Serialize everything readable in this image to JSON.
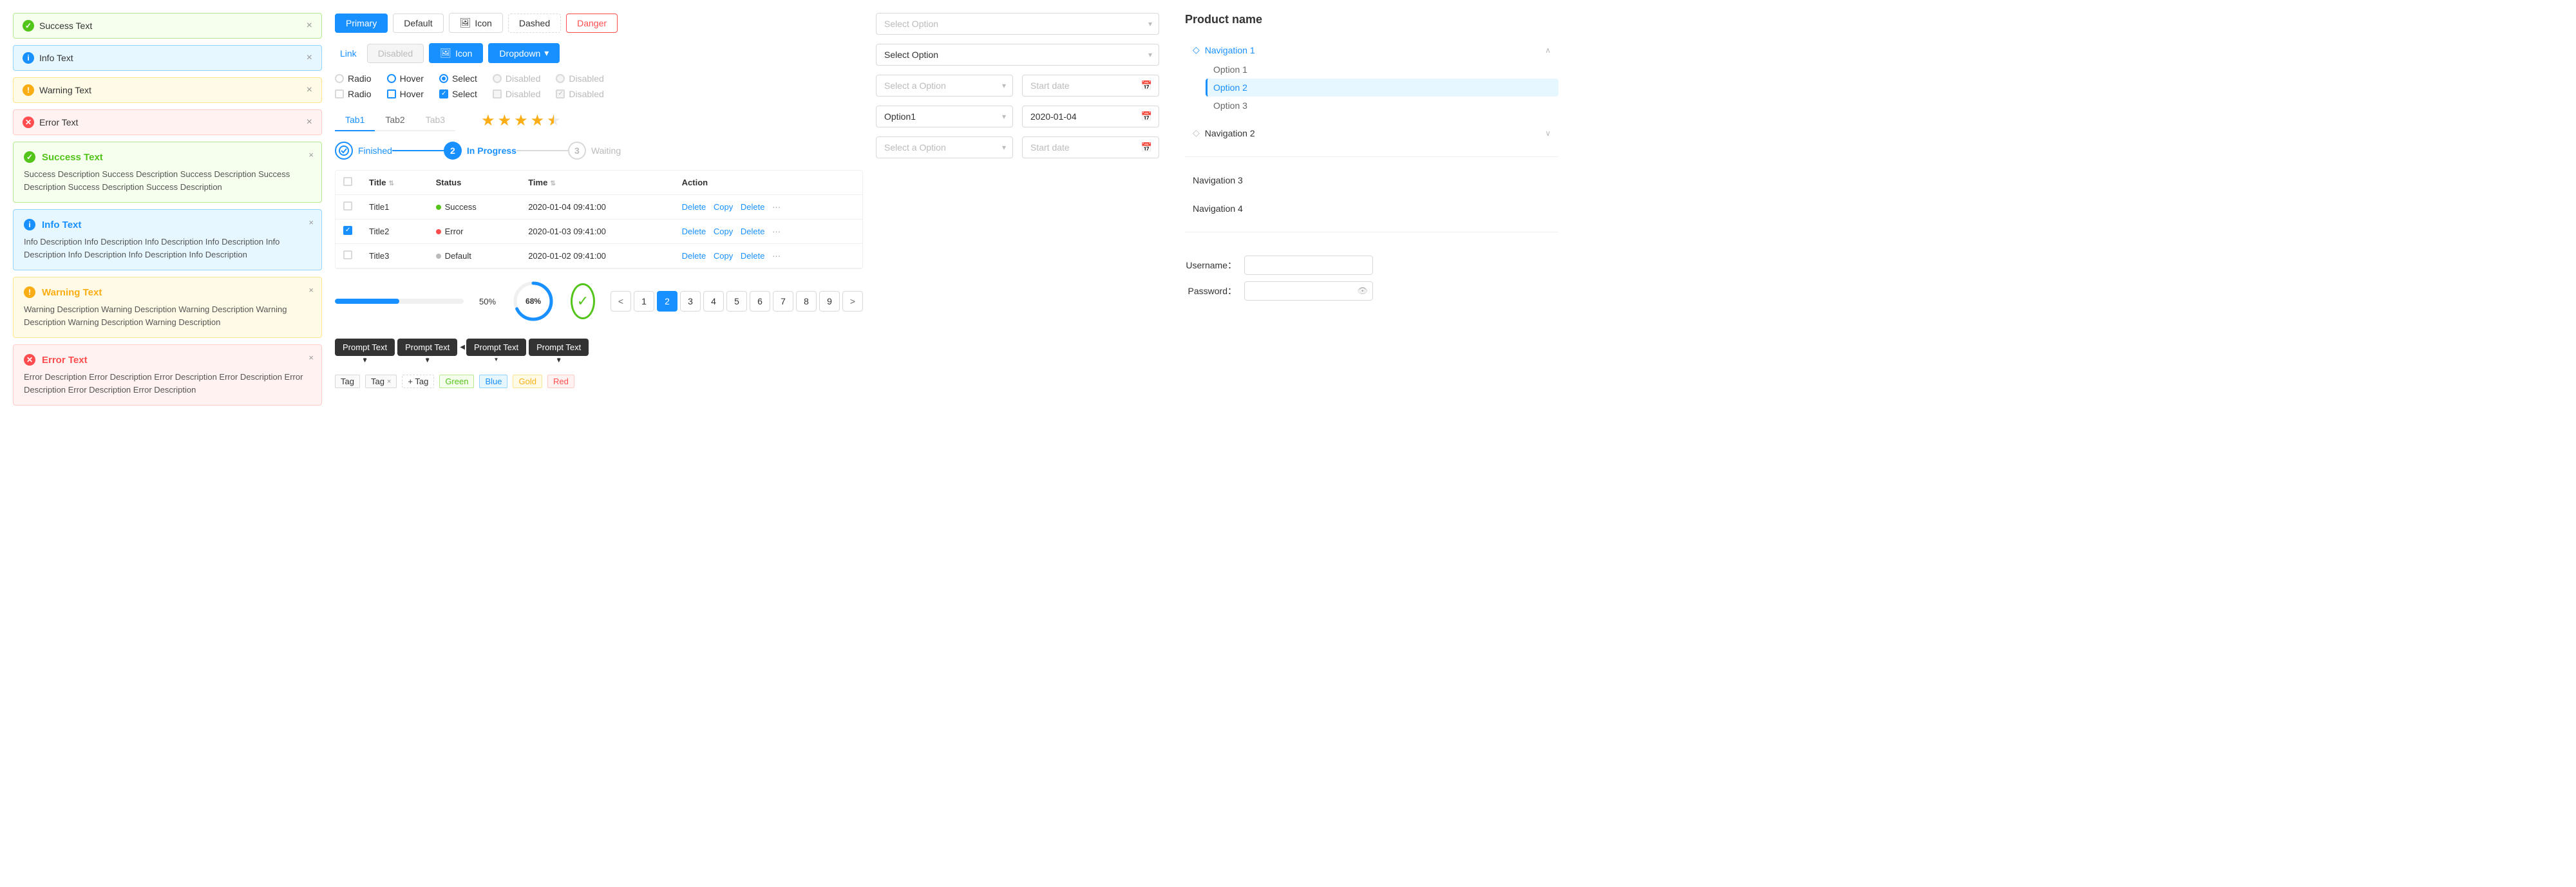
{
  "alerts": {
    "simple": [
      {
        "type": "success",
        "text": "Success Text",
        "icon": "✓"
      },
      {
        "type": "info",
        "text": "Info Text",
        "icon": "i"
      },
      {
        "type": "warning",
        "text": "Warning Text",
        "icon": "!"
      },
      {
        "type": "error",
        "text": "Error Text",
        "icon": "✕"
      }
    ],
    "detailed": [
      {
        "type": "success",
        "title": "Success Text",
        "desc": "Success Description Success Description Success Description Success Description Success Description Success Description",
        "icon": "✓"
      },
      {
        "type": "info",
        "title": "Info Text",
        "desc": "Info Description Info Description Info Description Info Description Info Description Info Description Info Description Info Description",
        "icon": "i"
      },
      {
        "type": "warning",
        "title": "Warning Text",
        "desc": "Warning Description Warning Description Warning Description Warning Description Warning Description Warning Description",
        "icon": "!"
      },
      {
        "type": "error",
        "title": "Error Text",
        "desc": "Error Description Error Description Error Description Error Description Error Description Error Description Error Description",
        "icon": "✕"
      }
    ]
  },
  "buttons": {
    "row1": [
      {
        "label": "Primary",
        "type": "primary"
      },
      {
        "label": "Default",
        "type": "default"
      },
      {
        "label": "Icon",
        "type": "icon",
        "hasIcon": true
      },
      {
        "label": "Dashed",
        "type": "dashed"
      },
      {
        "label": "Danger",
        "type": "danger"
      }
    ],
    "row2": [
      {
        "label": "Link",
        "type": "link"
      },
      {
        "label": "Disabled",
        "type": "disabled"
      },
      {
        "label": "Icon",
        "type": "icon-blue",
        "hasIcon": true
      },
      {
        "label": "Dropdown",
        "type": "dropdown",
        "hasArrow": true
      }
    ]
  },
  "checks": {
    "row1": [
      {
        "label": "Radio",
        "type": "radio",
        "state": "normal"
      },
      {
        "label": "Hover",
        "type": "radio",
        "state": "hover"
      },
      {
        "label": "Select",
        "type": "radio",
        "state": "selected"
      },
      {
        "label": "Disabled",
        "type": "radio",
        "state": "disabled"
      },
      {
        "label": "Disabled",
        "type": "radio",
        "state": "disabled"
      }
    ],
    "row2": [
      {
        "label": "Radio",
        "type": "check",
        "state": "normal"
      },
      {
        "label": "Hover",
        "type": "check",
        "state": "hover"
      },
      {
        "label": "Select",
        "type": "check",
        "state": "checked"
      },
      {
        "label": "Disabled",
        "type": "check",
        "state": "disabled"
      },
      {
        "label": "Disabled",
        "type": "check",
        "state": "disabled-checked"
      }
    ]
  },
  "tabs": {
    "items": [
      {
        "label": "Tab1",
        "active": true
      },
      {
        "label": "Tab2",
        "active": false
      },
      {
        "label": "Tab3",
        "active": false,
        "disabled": true
      }
    ]
  },
  "stars": {
    "count": 4,
    "half": true,
    "total": 5
  },
  "steps": [
    {
      "label": "Finished",
      "state": "done"
    },
    {
      "label": "In Progress",
      "state": "active",
      "num": "2"
    },
    {
      "label": "Waiting",
      "state": "waiting",
      "num": "3"
    }
  ],
  "table": {
    "columns": [
      "",
      "Title",
      "Status",
      "Time",
      "Action"
    ],
    "rows": [
      {
        "checked": false,
        "title": "Title1",
        "status": "Success",
        "statusType": "success",
        "time": "2020-01-04  09:41:00",
        "actions": [
          "Delete",
          "Copy",
          "Delete"
        ]
      },
      {
        "checked": true,
        "title": "Title2",
        "status": "Error",
        "statusType": "error",
        "time": "2020-01-03  09:41:00",
        "actions": [
          "Delete",
          "Copy",
          "Delete"
        ]
      },
      {
        "checked": false,
        "title": "Title3",
        "status": "Default",
        "statusType": "default",
        "time": "2020-01-02  09:41:00",
        "actions": [
          "Delete",
          "Copy",
          "Delete"
        ]
      }
    ]
  },
  "progress": {
    "bar": {
      "percent": 50,
      "label": "50%",
      "width": "50%"
    },
    "circle": {
      "percent": 68,
      "label": "68%"
    },
    "check": {
      "done": true
    }
  },
  "pagination": {
    "prev": "<",
    "next": ">",
    "pages": [
      "1",
      "2",
      "3",
      "4",
      "5",
      "6",
      "7",
      "8",
      "9"
    ],
    "active": "2"
  },
  "tooltips": [
    {
      "label": "Prompt Text"
    },
    {
      "label": "Prompt Text"
    },
    {
      "label": "Prompt Text"
    },
    {
      "label": "Prompt Text"
    }
  ],
  "tags": {
    "plain": [
      "Tag",
      "Tag"
    ],
    "close_label": "×",
    "add_label": "+ Tag",
    "colored": [
      "Green",
      "Blue",
      "Gold",
      "Red"
    ]
  },
  "selects": {
    "placeholder1": "Select a Option",
    "placeholder2": "Select a Option",
    "value1": "Option1",
    "startDate1": "Start date",
    "startDate2": "Start date",
    "date1": "2020-01-04"
  },
  "select_dropdowns": {
    "placeholder": "Select Option"
  },
  "navigation": {
    "title": "Product name",
    "items": [
      {
        "label": "Navigation 1",
        "icon": "◇",
        "active": true,
        "collapsed": false,
        "children": [
          {
            "label": "Option 1",
            "active": false
          },
          {
            "label": "Option 2",
            "active": true
          },
          {
            "label": "Option 3",
            "active": false
          }
        ]
      },
      {
        "label": "Navigation 2",
        "icon": "◇",
        "active": false,
        "collapsed": true
      },
      {
        "label": "Navigation 3",
        "active": false
      },
      {
        "label": "Navigation 4",
        "active": false
      }
    ]
  },
  "form": {
    "username_label": "Username：",
    "password_label": "Password：",
    "username_placeholder": "",
    "password_placeholder": ""
  }
}
